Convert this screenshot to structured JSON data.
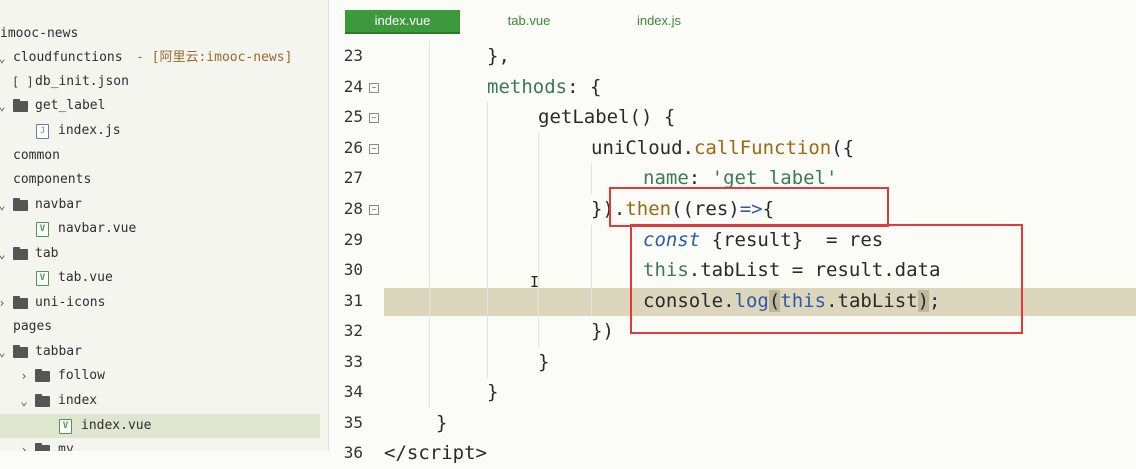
{
  "sidebar": {
    "project": "imooc-news",
    "cloudfunctions": "cloudfunctions",
    "cloud_alias": "- [阿里云:imooc-news]",
    "db_init": "db_init.json",
    "get_label": "get_label",
    "get_label_index": "index.js",
    "common": "common",
    "components": "components",
    "navbar": "navbar",
    "navbar_vue": "navbar.vue",
    "tab": "tab",
    "tab_vue": "tab.vue",
    "uni_icons": "uni-icons",
    "pages": "pages",
    "tabbar": "tabbar",
    "follow": "follow",
    "index": "index",
    "index_vue": "index.vue",
    "my": "my"
  },
  "tabs": [
    "index.vue",
    "tab.vue",
    "index.js"
  ],
  "editor": {
    "line_numbers": [
      "23",
      "24",
      "25",
      "26",
      "27",
      "28",
      "29",
      "30",
      "31",
      "32",
      "33",
      "34",
      "35",
      "36"
    ],
    "current_line": "31"
  },
  "colors": {
    "accent_green": "#3c9a3c",
    "highlight_box": "#e03a3a",
    "current_line_bg": "#dcd6bd"
  }
}
